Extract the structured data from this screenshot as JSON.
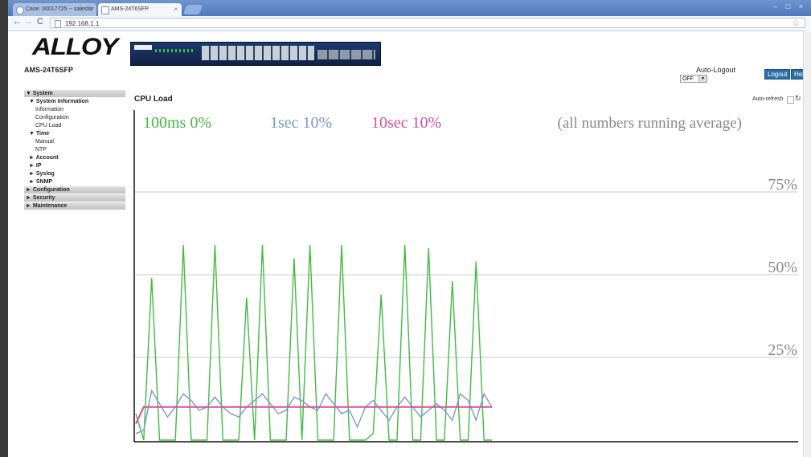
{
  "browser": {
    "tabs": [
      {
        "label": "Case: 00017725 -- salesfor",
        "active": false
      },
      {
        "label": "AMS-24T6SFP",
        "active": true
      }
    ],
    "url": "192.168.1.1"
  },
  "header": {
    "logo_text": "ALLOY",
    "model": "AMS-24T6SFP",
    "autologout_label": "Auto-Logout",
    "autologout_value": "OFF",
    "logout_label": "Logout",
    "help_label": "Help"
  },
  "menu": {
    "system": "▼ System",
    "system_information": "▼ System Information",
    "information": "Information",
    "configuration_item": "Configuration",
    "cpu_load": "CPU Load",
    "time": "▼ Time",
    "manual": "Manual",
    "ntp": "NTP",
    "account": "► Account",
    "ip": "► IP",
    "syslog": "► Syslog",
    "snmp": "► SNMP",
    "configuration": "► Configuration",
    "security": "► Security",
    "maintenance": "► Maintenance"
  },
  "page": {
    "title": "CPU Load",
    "autorefresh_label": "Auto-refresh"
  },
  "chart_data": {
    "type": "line",
    "legend": [
      {
        "name": "100ms",
        "value": "0%",
        "color": "#44b944"
      },
      {
        "name": "1sec",
        "value": "10%",
        "color": "#7b97d2"
      },
      {
        "name": "10sec",
        "value": "10%",
        "color": "#d84d9c"
      }
    ],
    "note": "(all numbers running average)",
    "gridlines": [
      "75%",
      "50%",
      "25%"
    ],
    "ylim": [
      0,
      100
    ],
    "series": [
      {
        "name": "100ms",
        "color": "#44b944",
        "values": [
          8,
          0,
          49,
          0,
          0,
          0,
          59,
          0,
          0,
          0,
          59,
          0,
          0,
          0,
          43,
          0,
          59,
          0,
          0,
          0,
          55,
          0,
          59,
          0,
          0,
          0,
          59,
          0,
          0,
          0,
          2,
          44,
          0,
          0,
          59,
          0,
          0,
          58,
          0,
          0,
          48,
          0,
          0,
          54,
          0,
          0
        ]
      },
      {
        "name": "1sec",
        "color": "#7b97d2",
        "values": [
          2,
          3,
          15,
          11,
          7,
          10,
          14,
          12,
          9,
          10,
          13,
          10,
          8,
          7,
          10,
          12,
          14,
          11,
          8,
          9,
          13,
          12,
          10,
          9,
          14,
          11,
          8,
          9,
          4,
          10,
          12,
          9,
          6,
          10,
          13,
          10,
          7,
          9,
          11,
          9,
          6,
          14,
          12,
          6,
          14,
          10
        ]
      },
      {
        "name": "10sec",
        "color": "#d84d9c",
        "values": [
          5,
          10,
          10,
          10,
          10,
          10,
          10,
          10,
          10,
          10,
          10,
          10,
          10,
          10,
          10,
          10,
          10,
          10,
          10,
          10,
          10,
          10,
          10,
          10,
          10,
          10,
          10,
          10,
          10,
          10,
          10,
          10,
          10,
          10,
          10,
          10,
          10,
          10,
          10,
          10,
          10,
          10,
          10,
          10,
          10,
          10
        ]
      }
    ]
  }
}
